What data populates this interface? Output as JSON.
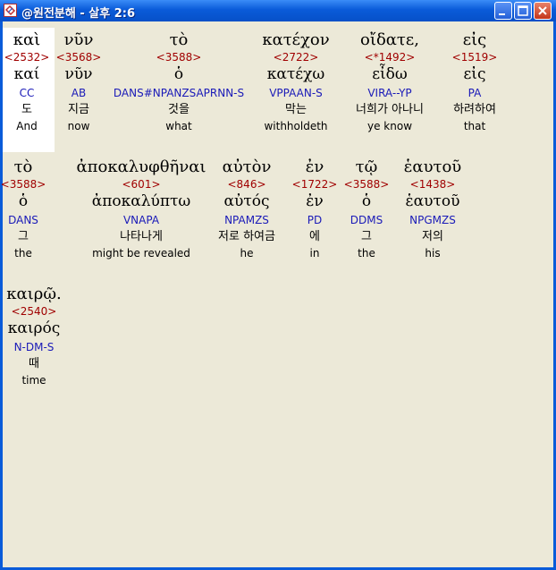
{
  "window": {
    "title": "@원전분해 - 살후 2:6",
    "icon": "app-icon"
  },
  "controls": {
    "minimize": "minimize-icon",
    "maximize": "maximize-icon",
    "close": "close-icon"
  },
  "selection": {
    "word_index": 0,
    "color": "#ffffff"
  },
  "colors": {
    "strong": "#a00000",
    "morph": "#1a1ab8",
    "titlebar": "#0a5bd9",
    "background": "#ece9d8"
  },
  "rows": [
    {
      "words": [
        {
          "greek": "καὶ",
          "strong": "<2532>",
          "lemma": "καί",
          "morph": "CC",
          "korean": "도",
          "english": "And"
        },
        {
          "greek": "νῦν",
          "strong": "<3568>",
          "lemma": "νῦν",
          "morph": "AB",
          "korean": "지금",
          "english": "now"
        },
        {
          "greek": "τὸ",
          "strong": "<3588>",
          "lemma": "ὁ",
          "morph": "DANS#NPANZS",
          "morph2": "APRNN-S",
          "korean": "것을",
          "english": "what"
        },
        {
          "greek": "κατέχον",
          "strong": "<2722>",
          "lemma": "κατέχω",
          "morph": "VPPAAN-S",
          "korean": "막는",
          "english": "withholdeth"
        },
        {
          "greek": "οἴδατε,",
          "strong": "<*1492>",
          "lemma": "εἶδω",
          "morph": "VIRA--YP",
          "korean": "너희가 아나니",
          "english": "ye know"
        },
        {
          "greek": "εἰς",
          "strong": "<1519>",
          "lemma": "εἰς",
          "morph": "PA",
          "korean": "하려하여",
          "english": "that"
        }
      ]
    },
    {
      "words": [
        {
          "greek": "τὸ",
          "strong": "<3588>",
          "lemma": "ὁ",
          "morph": "DANS",
          "korean": "그",
          "english": "the"
        },
        {
          "greek": "ἀποκαλυφθῆναι",
          "strong": "<601>",
          "lemma": "ἀποκαλύπτω",
          "morph": "VNAPA",
          "korean": "나타나게",
          "english": "might be revealed"
        },
        {
          "greek": "αὐτὸν",
          "strong": "<846>",
          "lemma": "αὐτός",
          "morph": "NPAMZS",
          "korean": "저로 하여금",
          "english": "he"
        },
        {
          "greek": "ἐν",
          "strong": "<1722>",
          "lemma": "ἐν",
          "morph": "PD",
          "korean": "에",
          "english": "in"
        },
        {
          "greek": "τῷ",
          "strong": "<3588>",
          "lemma": "ὁ",
          "morph": "DDMS",
          "korean": "그",
          "english": "the"
        },
        {
          "greek": "ἑαυτοῦ",
          "strong": "<1438>",
          "lemma": "ἑαυτοῦ",
          "morph": "NPGMZS",
          "korean": "저의",
          "english": "his"
        }
      ]
    },
    {
      "words": [
        {
          "greek": "καιρῷ.",
          "strong": "<2540>",
          "lemma": "καιρός",
          "morph": "N-DM-S",
          "korean": "때",
          "english": "time"
        }
      ]
    }
  ]
}
